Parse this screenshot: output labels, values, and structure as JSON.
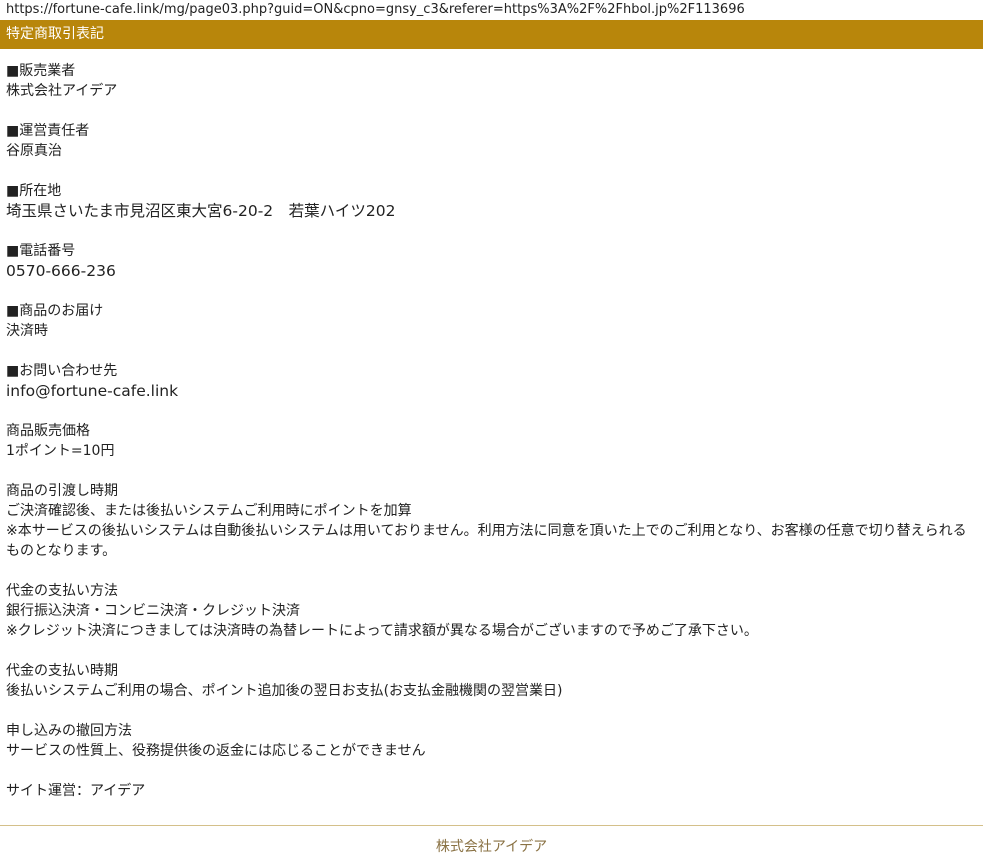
{
  "url": "https://fortune-cafe.link/mg/page03.php?guid=ON&cpno=gnsy_c3&referer=https%3A%2F%2Fhbol.jp%2F113696",
  "header_title": "特定商取引表記",
  "sections": {
    "seller": {
      "heading": "■販売業者",
      "body": "株式会社アイデア"
    },
    "manager": {
      "heading": "■運営責任者",
      "body": "谷原真治"
    },
    "address": {
      "heading": "■所在地",
      "body": "埼玉県さいたま市見沼区東大宮6-20-2　若葉ハイツ202"
    },
    "phone": {
      "heading": "■電話番号",
      "body": "0570-666-236"
    },
    "delivery": {
      "heading": "■商品のお届け",
      "body": "決済時"
    },
    "contact": {
      "heading": "■お問い合わせ先",
      "body": "info@fortune-cafe.link"
    },
    "price": {
      "heading": "商品販売価格",
      "body": "1ポイント=10円"
    },
    "handover": {
      "heading": "商品の引渡し時期",
      "body_lines": [
        "ご決済確認後、または後払いシステムご利用時にポイントを加算",
        "※本サービスの後払いシステムは自動後払いシステムは用いておりません。利用方法に同意を頂いた上でのご利用となり、お客様の任意で切り替えられるものとなります。"
      ]
    },
    "payment_method": {
      "heading": "代金の支払い方法",
      "body_lines": [
        "銀行振込決済・コンビニ決済・クレジット決済",
        "※クレジット決済につきましては決済時の為替レートによって請求額が異なる場合がございますので予めご了承下さい。"
      ]
    },
    "payment_timing": {
      "heading": "代金の支払い時期",
      "body": "後払いシステムご利用の場合、ポイント追加後の翌日お支払(お支払金融機関の翌営業日)"
    },
    "cancellation": {
      "heading": "申し込みの撤回方法",
      "body": "サービスの性質上、役務提供後の返金には応じることができません"
    },
    "operator": "サイト運営：アイデア"
  },
  "footer_text": "株式会社アイデア",
  "colors": {
    "header_bg": "#b8860b",
    "footer_text": "#8a7244",
    "footer_line": "#d4c08a"
  }
}
